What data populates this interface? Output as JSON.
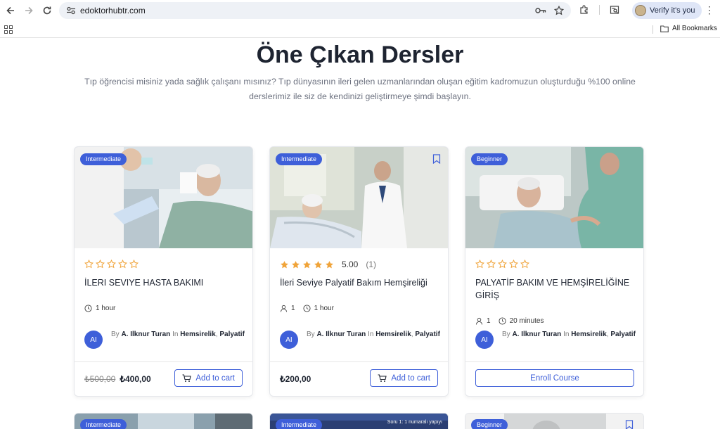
{
  "browser": {
    "url": "edoktorhubtr.com",
    "profile_label": "Verify it's you",
    "all_bookmarks": "All Bookmarks"
  },
  "section": {
    "title": "Öne Çıkan Dersler",
    "subtitle": "Tıp öğrencisi misiniz yada sağlık çalışanı mısınız? Tıp dünyasının ileri gelen uzmanlarından oluşan eğitim kadromuzun oluşturduğu %100 online derslerimiz ile siz de kendinizi geliştirmeye şimdi başlayın."
  },
  "cards": [
    {
      "level": "Intermediate",
      "rating_text": "",
      "rating_count": "",
      "title": "İLERI SEVIYE HASTA BAKIMI",
      "students": "",
      "duration": "1 hour",
      "author_initials": "AI",
      "by": "By",
      "author": "A. Ilknur Turan",
      "in": "In",
      "category1": "Hemsirelik",
      "category2": "Palyatif",
      "old_price": "₺500,00",
      "price": "₺400,00",
      "action": "Add to cart",
      "stars_filled": 0
    },
    {
      "level": "Intermediate",
      "rating_text": "5.00",
      "rating_count": "(1)",
      "title": "İleri Seviye Palyatif Bakım Hemşireliği",
      "students": "1",
      "duration": "1 hour",
      "author_initials": "AI",
      "by": "By",
      "author": "A. Ilknur Turan",
      "in": "In",
      "category1": "Hemsirelik",
      "category2": "Palyatif",
      "old_price": "",
      "price": "₺200,00",
      "action": "Add to cart",
      "stars_filled": 5
    },
    {
      "level": "Beginner",
      "rating_text": "",
      "rating_count": "",
      "title": "PALYATİF BAKIM VE HEMŞİRELİĞİNE GİRİŞ",
      "students": "1",
      "duration": "20 minutes",
      "author_initials": "AI",
      "by": "By",
      "author": "A. Ilknur Turan",
      "in": "In",
      "category1": "Hemsirelik",
      "category2": "Palyatif",
      "old_price": "",
      "price": "",
      "action": "Enroll Course",
      "stars_filled": 0
    }
  ],
  "row2": [
    {
      "level": "Intermediate"
    },
    {
      "level": "Intermediate",
      "overlay": "Soru 1: 1 numaralı yapıyı"
    },
    {
      "level": "Beginner"
    }
  ],
  "colors": {
    "accent": "#3e5fd9",
    "star": "#f0a43a",
    "heading": "#1e2431"
  }
}
